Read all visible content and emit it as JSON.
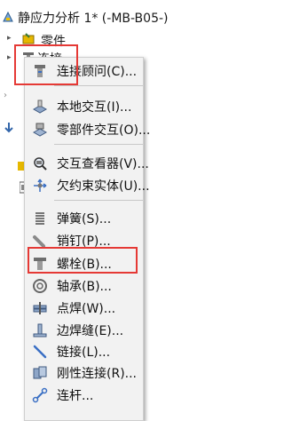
{
  "tree": {
    "study_title": "静应力分析 1* (-MB-B05-)",
    "parts_label": "零件",
    "connections_label": "连接"
  },
  "menu": {
    "items": [
      {
        "label": "连接顾问(C)...",
        "icon": "connection-advisor-icon"
      },
      {
        "label": "本地交互(I)...",
        "icon": "local-interaction-icon"
      },
      {
        "label": "零部件交互(O)...",
        "icon": "component-interaction-icon"
      },
      {
        "label": "交互查看器(V)...",
        "icon": "interaction-viewer-icon"
      },
      {
        "label": "欠约束实体(U)...",
        "icon": "under-constrained-icon"
      },
      {
        "label": "弹簧(S)...",
        "icon": "spring-icon"
      },
      {
        "label": "销钉(P)...",
        "icon": "pin-icon"
      },
      {
        "label": "螺栓(B)...",
        "icon": "bolt-icon"
      },
      {
        "label": "轴承(B)...",
        "icon": "bearing-icon"
      },
      {
        "label": "点焊(W)...",
        "icon": "spot-weld-icon"
      },
      {
        "label": "边焊缝(E)...",
        "icon": "edge-weld-icon"
      },
      {
        "label": "链接(L)...",
        "icon": "link-icon"
      },
      {
        "label": "刚性连接(R)...",
        "icon": "rigid-connection-icon"
      },
      {
        "label": "连杆...",
        "icon": "connecting-rod-icon"
      }
    ]
  },
  "colors": {
    "highlight": "#e53935",
    "menu_bg": "#f2f2f2"
  }
}
